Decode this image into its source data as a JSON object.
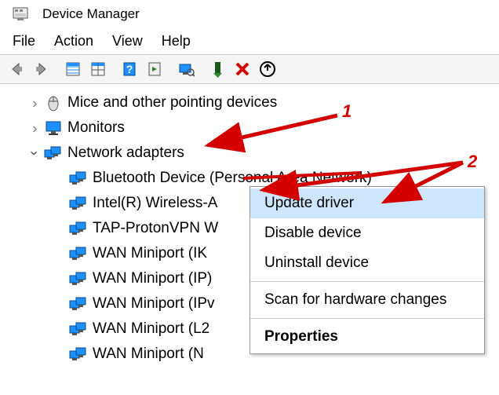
{
  "window": {
    "title": "Device Manager"
  },
  "menu": {
    "file": "File",
    "action": "Action",
    "view": "View",
    "help": "Help"
  },
  "tree": {
    "mice": {
      "label": "Mice and other pointing devices"
    },
    "monitors": {
      "label": "Monitors"
    },
    "netadapters": {
      "label": "Network adapters"
    },
    "children": {
      "bt": {
        "label": "Bluetooth Device (Personal Area Network)"
      },
      "intel": {
        "label": "Intel(R) Wireless-A"
      },
      "tap": {
        "label": "TAP-ProtonVPN W"
      },
      "wan_ik": {
        "label": "WAN Miniport (IK"
      },
      "wan_ip": {
        "label": "WAN Miniport (IP)"
      },
      "wan_ipv": {
        "label": "WAN Miniport (IPv"
      },
      "wan_l2": {
        "label": "WAN Miniport (L2"
      },
      "wan_n": {
        "label": "WAN Miniport (N"
      }
    }
  },
  "context_menu": {
    "update": "Update driver",
    "disable": "Disable device",
    "uninstall": "Uninstall device",
    "scan": "Scan for hardware changes",
    "properties": "Properties"
  },
  "annotations": {
    "one": "1",
    "two": "2"
  }
}
